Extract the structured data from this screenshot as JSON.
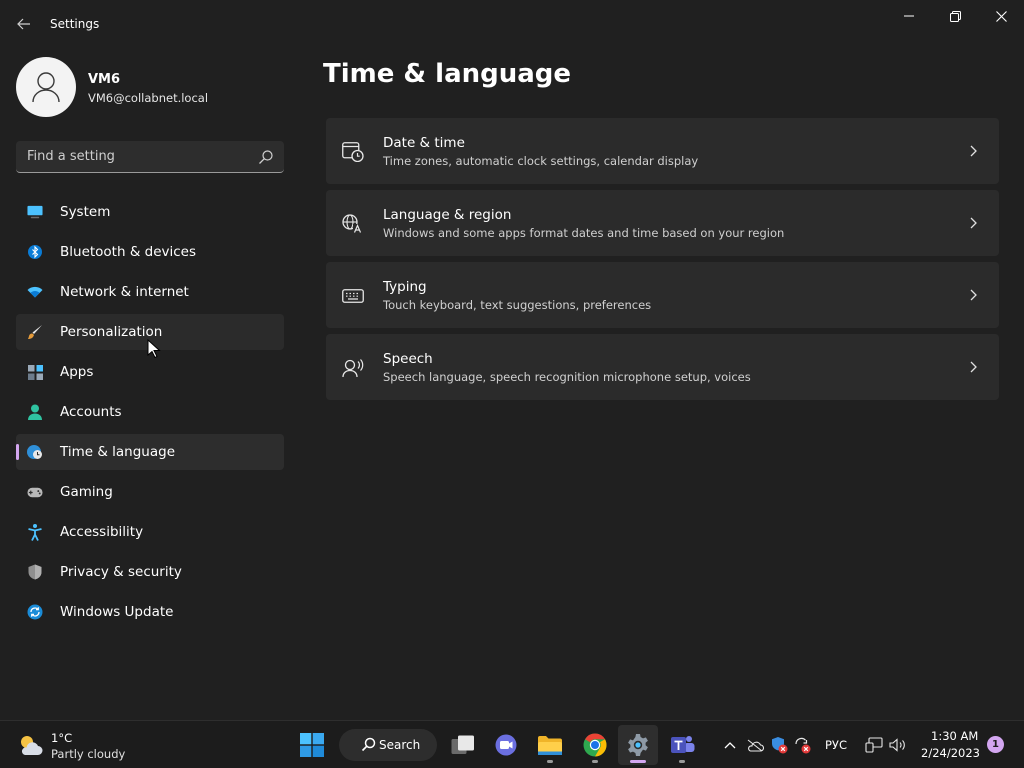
{
  "window": {
    "title": "Settings"
  },
  "profile": {
    "name": "VM6",
    "email": "VM6@collabnet.local"
  },
  "search": {
    "placeholder": "Find a setting"
  },
  "nav": {
    "items": [
      {
        "label": "System",
        "icon": "system-icon"
      },
      {
        "label": "Bluetooth & devices",
        "icon": "bluetooth-icon"
      },
      {
        "label": "Network & internet",
        "icon": "network-icon"
      },
      {
        "label": "Personalization",
        "icon": "brush-icon"
      },
      {
        "label": "Apps",
        "icon": "apps-icon"
      },
      {
        "label": "Accounts",
        "icon": "person-icon"
      },
      {
        "label": "Time & language",
        "icon": "globe-clock-icon",
        "selected": true
      },
      {
        "label": "Gaming",
        "icon": "gamepad-icon"
      },
      {
        "label": "Accessibility",
        "icon": "accessibility-icon"
      },
      {
        "label": "Privacy & security",
        "icon": "shield-icon"
      },
      {
        "label": "Windows Update",
        "icon": "update-icon"
      }
    ]
  },
  "main": {
    "title": "Time & language",
    "cards": [
      {
        "title": "Date & time",
        "description": "Time zones, automatic clock settings, calendar display",
        "icon": "calendar-clock-icon"
      },
      {
        "title": "Language & region",
        "description": "Windows and some apps format dates and time based on your region",
        "icon": "language-icon"
      },
      {
        "title": "Typing",
        "description": "Touch keyboard, text suggestions, preferences",
        "icon": "keyboard-icon"
      },
      {
        "title": "Speech",
        "description": "Speech language, speech recognition microphone setup, voices",
        "icon": "speech-icon"
      }
    ]
  },
  "taskbar": {
    "weather": {
      "temp": "1°C",
      "condition": "Partly cloudy"
    },
    "search_label": "Search",
    "language": "РУС",
    "time": "1:30 AM",
    "date": "2/24/2023",
    "notification_count": "1"
  },
  "colors": {
    "accent": "#d3a6f0",
    "background": "#202020",
    "card": "#2b2b2b"
  }
}
